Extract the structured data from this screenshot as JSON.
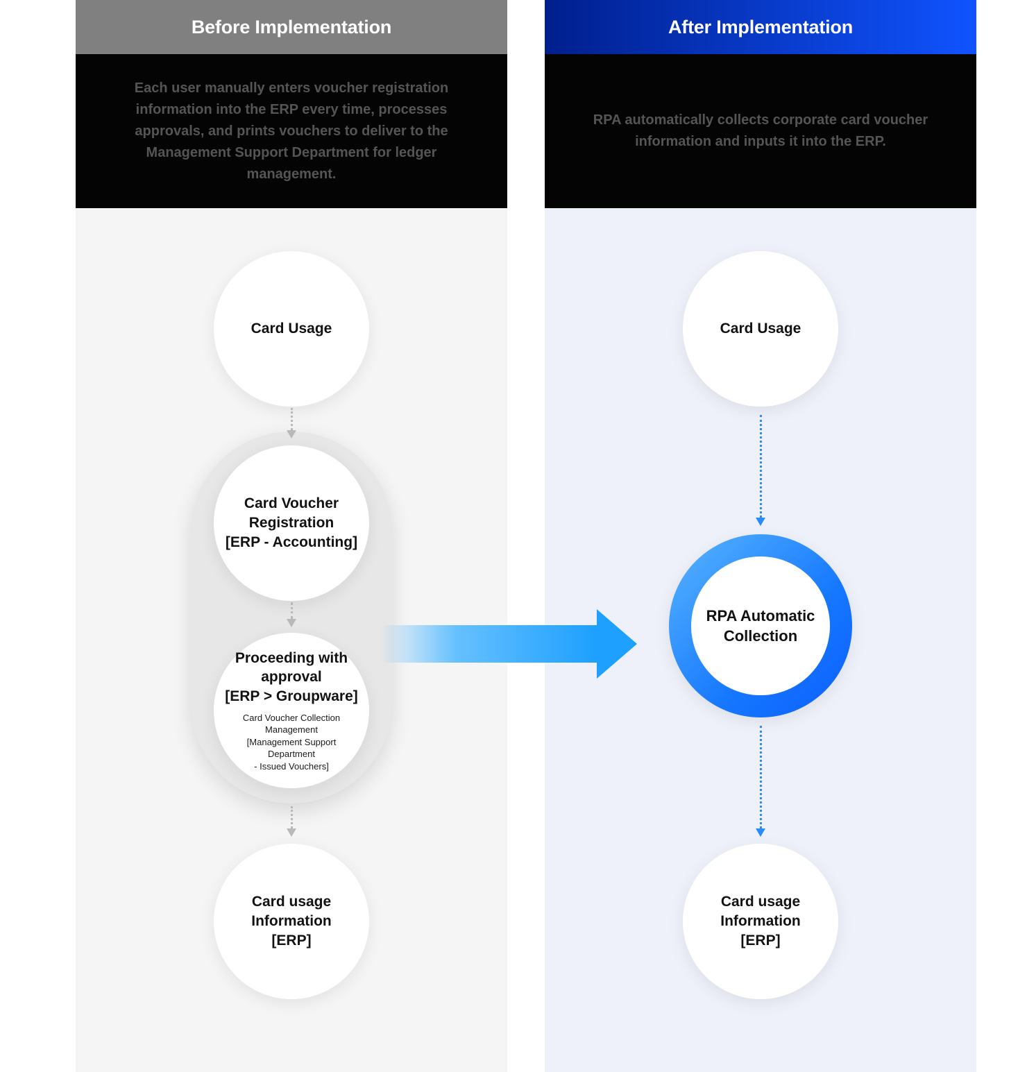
{
  "before": {
    "title": "Before Implementation",
    "description": "Each user manually enters voucher registration information into the ERP every time, processes approvals, and prints vouchers to deliver to the Management Support Department for ledger management.",
    "nodes": {
      "card_usage": "Card Usage",
      "voucher_reg": "Card Voucher Registration\n[ERP - Accounting]",
      "approval_main": "Proceeding with approval\n[ERP > Groupware]",
      "approval_sub": "Card Voucher Collection Management\n[Management Support Department\n- Issued Vouchers]",
      "usage_info": "Card usage Information\n[ERP]"
    }
  },
  "after": {
    "title": "After Implementation",
    "description": "RPA automatically collects corporate card voucher information and inputs it into the ERP.",
    "nodes": {
      "card_usage": "Card Usage",
      "rpa": "RPA Automatic Collection",
      "usage_info": "Card usage Information\n[ERP]"
    }
  }
}
